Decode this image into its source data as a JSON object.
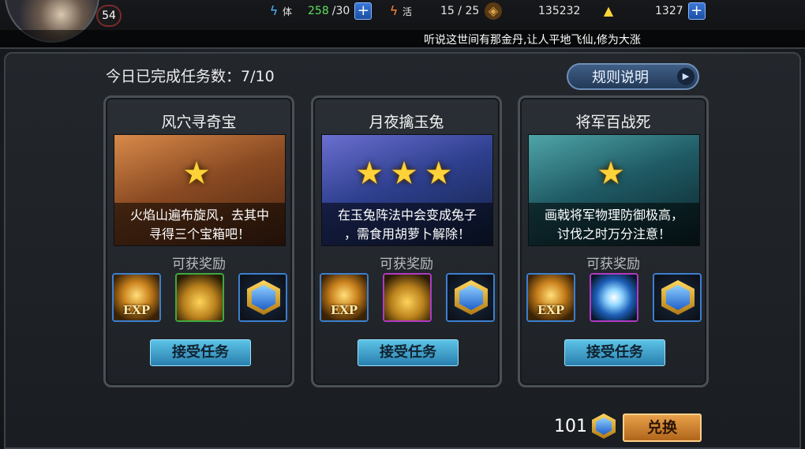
{
  "header": {
    "level": "54",
    "stamina": {
      "label": "体",
      "current": "258",
      "max": "/30"
    },
    "activity": {
      "label": "活",
      "value": "15 / 25"
    },
    "coins": "135232",
    "ingots": "1327",
    "ticker": "听说这世间有那金丹,让人平地飞仙,修为大涨"
  },
  "main": {
    "progress_text": "今日已完成任务数：7/10",
    "rules_label": "规则说明"
  },
  "cards": [
    {
      "title": "风穴寻奇宝",
      "stars": "★",
      "desc_line1": "火焰山遍布旋风，去其中",
      "desc_line2": "寻得三个宝箱吧！",
      "reward_label": "可获奖励",
      "rewards": [
        "exp",
        "gold-coins",
        "gem-hex"
      ],
      "accept_label": "接受任务"
    },
    {
      "title": "月夜擒玉兔",
      "stars": "★★★",
      "desc_line1": "在玉兔阵法中会变成兔子",
      "desc_line2": "，需食用胡萝卜解除！",
      "reward_label": "可获奖励",
      "rewards": [
        "exp",
        "gold-bag",
        "gem-hex"
      ],
      "accept_label": "接受任务"
    },
    {
      "title": "将军百战死",
      "stars": "★",
      "desc_line1": "画戟将军物理防御极高，",
      "desc_line2": "讨伐之时万分注意！",
      "reward_label": "可获奖励",
      "rewards": [
        "exp",
        "spirit-orb",
        "gem-hex"
      ],
      "accept_label": "接受任务"
    }
  ],
  "exp_text": "EXP",
  "footer": {
    "currency_amount": "101",
    "exchange_label": "兑换"
  },
  "colors": {
    "accept_button": "#3b9ccb",
    "exchange_button": "#d08634",
    "star": "#ffd23a"
  }
}
